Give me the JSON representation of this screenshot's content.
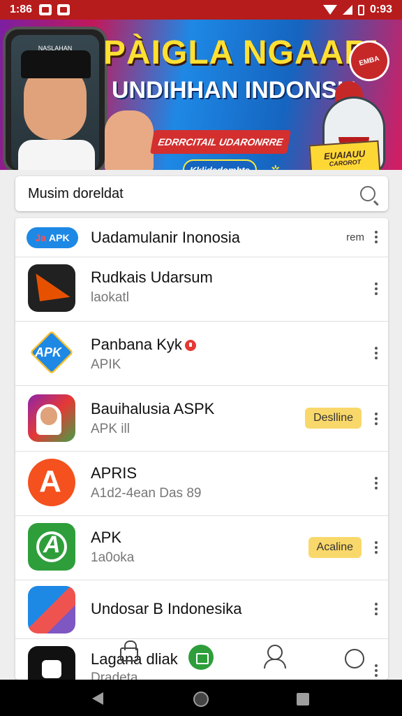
{
  "status_bar": {
    "time": "1:86",
    "battery_time": "0:93"
  },
  "banner": {
    "headline_1": "PÀIGLA NGAARI",
    "headline_2": "UNDIHHAN INDONSIA",
    "red_bar_text": "EDRRCITAIL UDARONRRE",
    "button_text": "Kklidedombte",
    "corner_badge": "EMBA",
    "yellow_tag_line1": "EUAIAUU",
    "yellow_tag_line2": "CAROROT"
  },
  "search": {
    "placeholder": "Musim doreldat"
  },
  "apps": [
    {
      "title": "Uadamulanir Inonosia",
      "badge_text": "APK",
      "badge_prefix": "Ja",
      "trailing": "rem"
    },
    {
      "title": "Rudkais Udarsum",
      "subtitle": "laokatl"
    },
    {
      "title": "Panbana Kyk",
      "subtitle": "APIK"
    },
    {
      "title": "Bauihalusia ASPK",
      "subtitle": "APK ill",
      "status": "Deslline"
    },
    {
      "title": "APRIS",
      "subtitle": "A1d2-4ean Das 89"
    },
    {
      "title": "APK",
      "subtitle": "1a0oka",
      "status": "Acaline"
    },
    {
      "title": "Undosar B Indonesika"
    },
    {
      "title": "Lagana dliak",
      "subtitle": "Dradeta"
    }
  ],
  "icons": {
    "nav_lock": "lock-icon",
    "nav_home": "home-icon",
    "nav_profile": "person-icon",
    "nav_support": "support-icon"
  },
  "colors": {
    "status_bar": "#b71c1c",
    "pill_yellow": "#f9d86b",
    "accent_green": "#2e9e3b",
    "accent_blue": "#1e88e5"
  }
}
